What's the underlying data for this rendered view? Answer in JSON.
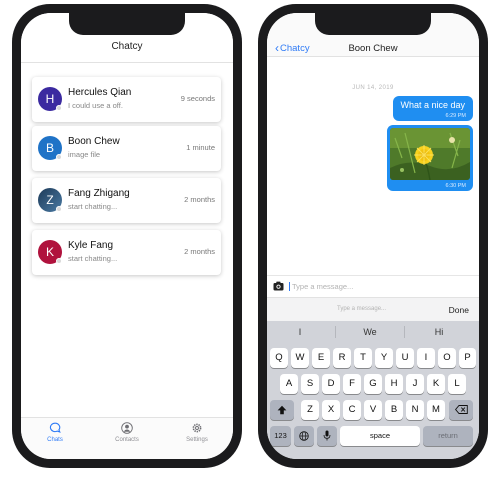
{
  "left_phone": {
    "title": "Chatcy",
    "chats": [
      {
        "initial": "H",
        "name": "Hercules Qian",
        "subtitle": "I could use a off.",
        "time": "9 seconds",
        "avatar_color": "#3b2aa0"
      },
      {
        "initial": "B",
        "name": "Boon Chew",
        "subtitle": "image file",
        "time": "1 minute",
        "avatar_color": "#1f73c7"
      },
      {
        "initial": "Z",
        "name": "Fang Zhigang",
        "subtitle": "start chatting...",
        "time": "2 months",
        "avatar_color": "#2e4f6e"
      },
      {
        "initial": "K",
        "name": "Kyle Fang",
        "subtitle": "start chatting...",
        "time": "2 months",
        "avatar_color": "#b0123d"
      }
    ],
    "tabs": [
      {
        "label": "Chats",
        "icon": "chat-bubble-icon",
        "active": true
      },
      {
        "label": "Contacts",
        "icon": "person-icon",
        "active": false
      },
      {
        "label": "Settings",
        "icon": "gear-icon",
        "active": false
      }
    ]
  },
  "right_phone": {
    "back_label": "Chatcy",
    "title": "Boon Chew",
    "date_separator": "JUN 14, 2019",
    "messages": [
      {
        "text": "What a nice day",
        "time": "6:29 PM"
      },
      {
        "image": "dandelion-photo",
        "time": "6:30 PM"
      }
    ],
    "composer": {
      "placeholder": "Type a message..."
    },
    "accessory": {
      "placeholder": "Type a message...",
      "done_label": "Done"
    },
    "suggestions": [
      "I",
      "We",
      "Hi"
    ],
    "keyboard": {
      "row1": [
        "Q",
        "W",
        "E",
        "R",
        "T",
        "Y",
        "U",
        "I",
        "O",
        "P"
      ],
      "row2": [
        "A",
        "S",
        "D",
        "F",
        "G",
        "H",
        "J",
        "K",
        "L"
      ],
      "row3": [
        "Z",
        "X",
        "C",
        "V",
        "B",
        "N",
        "M"
      ],
      "num_key": "123",
      "space_key": "space",
      "return_key": "return"
    }
  },
  "colors": {
    "accent": "#2f7bf6",
    "bubble": "#1f8ef1",
    "keyboard_bg": "#d1d3d9"
  }
}
